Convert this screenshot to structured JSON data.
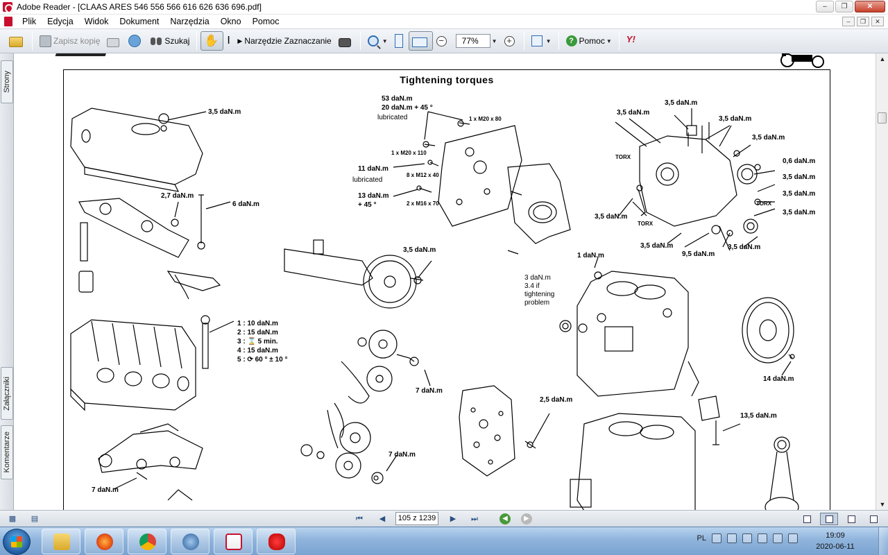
{
  "window": {
    "title": "Adobe Reader - [CLAAS ARES 546 556 566 616 626 636 696.pdf]"
  },
  "menu": [
    "Plik",
    "Edycja",
    "Widok",
    "Dokument",
    "Narzędzia",
    "Okno",
    "Pomoc"
  ],
  "toolbar": {
    "save_copy": "Zapisz kopię",
    "search": "Szukaj",
    "select_tool": "Narzędzie Zaznaczanie",
    "zoom_value": "77%",
    "help": "Pomoc",
    "yahoo": "Y!"
  },
  "side_tabs": [
    "Strony",
    "Załączniki",
    "Komentarze"
  ],
  "document": {
    "title": "Tightening  torques",
    "labels": {
      "cover": "3,5 daN.m",
      "rocker_small": "2,7 daN.m",
      "rocker_stud": "6 daN.m",
      "head_seq_1": "1 : 10 daN.m",
      "head_seq_2": "2 : 15 daN.m",
      "head_seq_3": "3 : ⌛ 5 min.",
      "head_seq_4": "4 : 15 daN.m",
      "head_seq_5": "5 : ⟳ 60 ° ± 10 °",
      "manifold": "7 daN.m",
      "housing_53": "53 daN.m",
      "housing_20": "20 daN.m + 45 °",
      "housing_lub": "lubricated",
      "m20x80": "1 x M20 x 80",
      "m20x110": "1 x M20 x 110",
      "housing_11": "11 daN.m",
      "housing_11_lub": "lubricated",
      "m12x40": "8 x M12 x 40",
      "housing_13": "13 daN.m",
      "housing_13_deg": "+ 45 °",
      "m16x70": "2 x M16 x 70",
      "camshaft": "3,5 daN.m",
      "gear_7a": "7 daN.m",
      "gear_7b": "7 daN.m",
      "front_plate": "2,5 daN.m",
      "pump_a": "3,5 daN.m",
      "pump_b": "3,5 daN.m",
      "pump_c": "3,5 daN.m",
      "pump_d": "3,5 daN.m",
      "pump_e": "0,6 daN.m",
      "pump_f": "3,5 daN.m",
      "pump_g": "3,5 daN.m",
      "pump_h": "3,5 daN.m",
      "pump_i": "3,5 daN.m",
      "pump_j": "3,5 daN.m",
      "pump_k": "3,5 daN.m",
      "pump_95": "9,5 daN.m",
      "torx_a": "TORX",
      "torx_b": "TORX",
      "torx_c": "TORX",
      "block_1": "1 daN.m",
      "block_3": "3 daN.m\n3.4 if\ntightening\nproblem",
      "flywheel": "14 daN.m",
      "bearing_cap": "13,5 daN.m"
    }
  },
  "statusbar": {
    "page_indicator": "105 z 1239"
  },
  "taskbar": {
    "language": "PL",
    "time": "19:09",
    "date": "2020-06-11"
  }
}
